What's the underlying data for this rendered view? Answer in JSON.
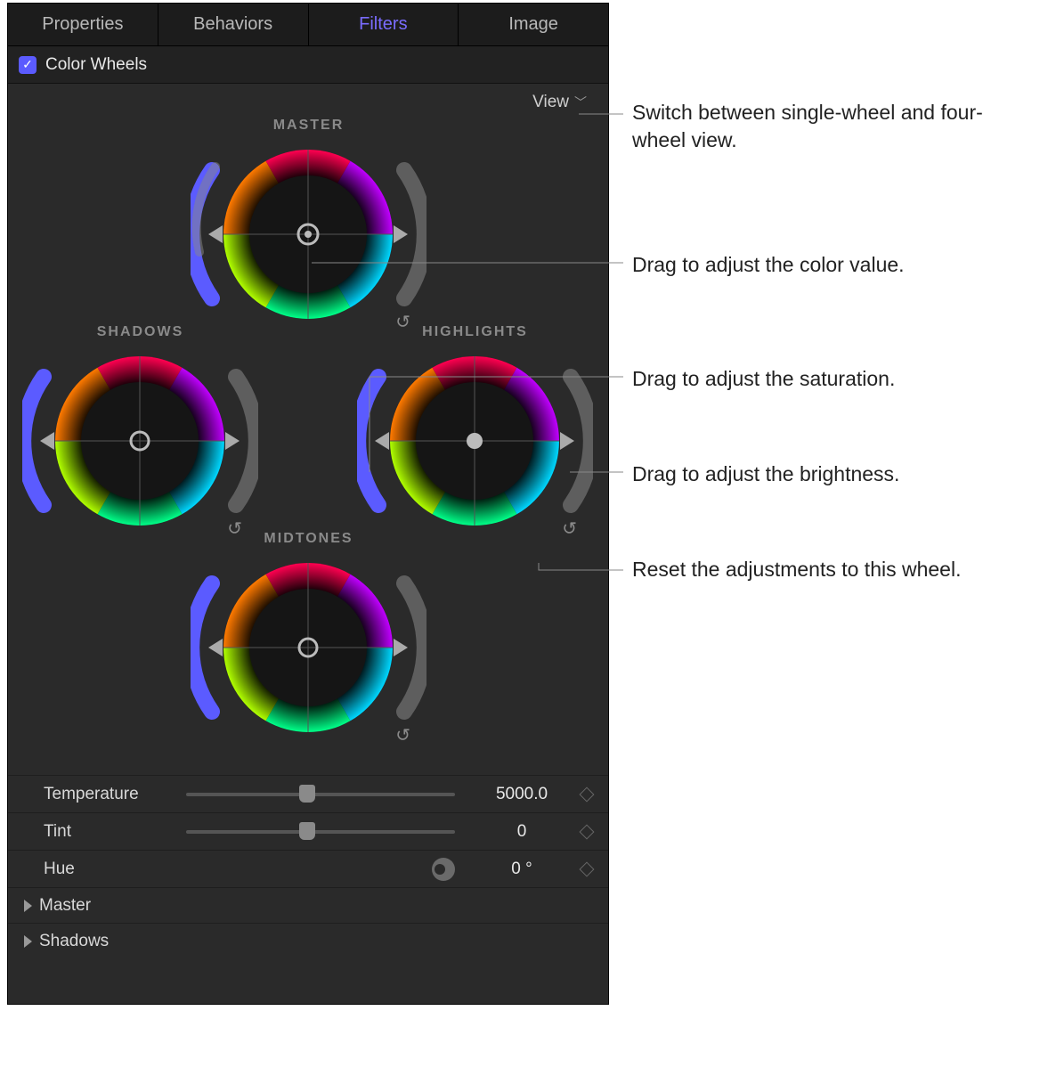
{
  "tabs": [
    "Properties",
    "Behaviors",
    "Filters",
    "Image"
  ],
  "active_tab": "Filters",
  "section": {
    "title": "Color Wheels",
    "checked": true
  },
  "view_label": "View",
  "wheels": {
    "master": {
      "label": "MASTER"
    },
    "shadows": {
      "label": "SHADOWS"
    },
    "highlights": {
      "label": "HIGHLIGHTS"
    },
    "midtones": {
      "label": "MIDTONES"
    }
  },
  "params": {
    "temperature": {
      "label": "Temperature",
      "value": "5000.0",
      "knob_pct": 42
    },
    "tint": {
      "label": "Tint",
      "value": "0",
      "knob_pct": 42
    },
    "hue": {
      "label": "Hue",
      "value": "0 °"
    }
  },
  "disclosures": [
    "Master",
    "Shadows"
  ],
  "callouts": {
    "view": "Switch between single-wheel and four-wheel view.",
    "colorvalue": "Drag to adjust the color value.",
    "saturation": "Drag to adjust the saturation.",
    "brightness": "Drag to adjust the brightness.",
    "reset": "Reset the adjustments to this wheel."
  }
}
